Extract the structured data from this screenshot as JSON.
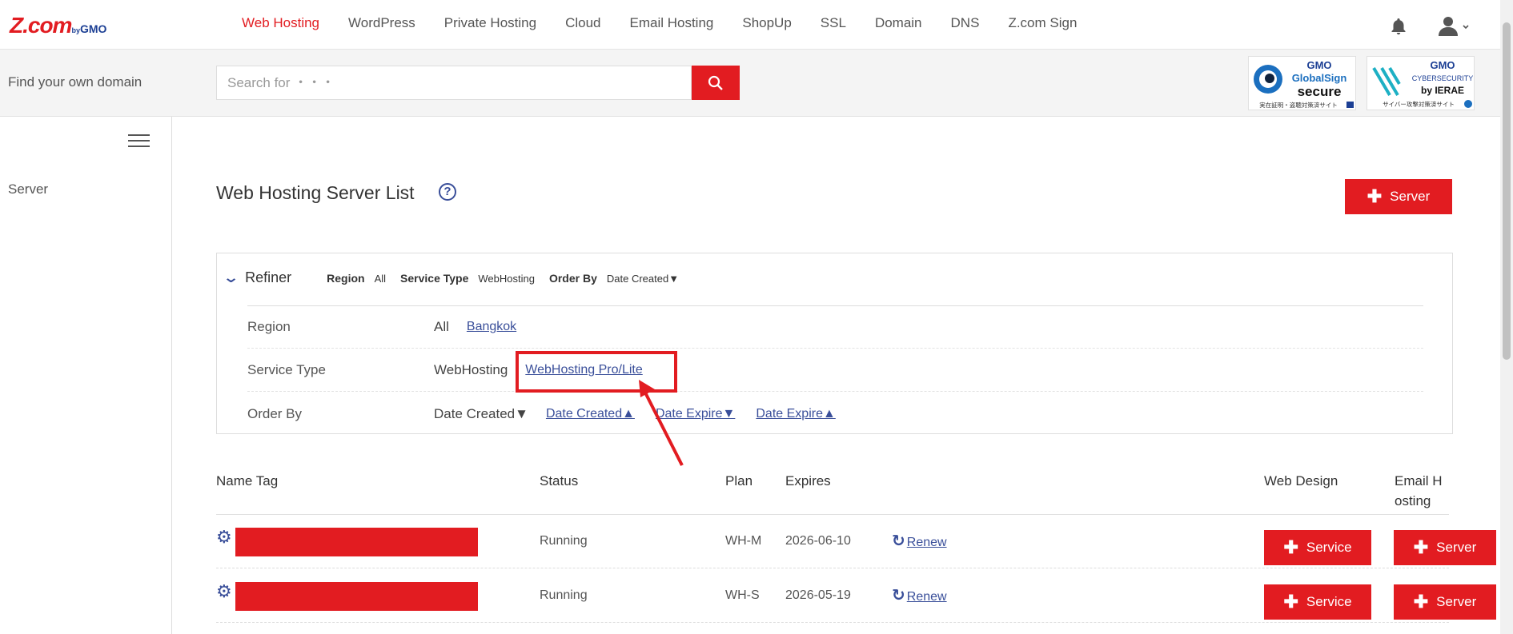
{
  "brand": {
    "logo_main": "Z.com",
    "logo_by": "by",
    "logo_gmo": "GMO"
  },
  "nav": {
    "items": [
      {
        "label": "Web Hosting",
        "active": true
      },
      {
        "label": "WordPress"
      },
      {
        "label": "Private Hosting"
      },
      {
        "label": "Cloud"
      },
      {
        "label": "Email Hosting"
      },
      {
        "label": "ShopUp"
      },
      {
        "label": "SSL"
      },
      {
        "label": "Domain"
      },
      {
        "label": "DNS"
      },
      {
        "label": "Z.com Sign"
      }
    ]
  },
  "search": {
    "label": "Find your own domain",
    "placeholder": "Search for ・・・"
  },
  "badges": {
    "globalsign": {
      "line1": "GMO",
      "line2": "GlobalSign",
      "line3": "secure",
      "line4": "実在証明・盗聴対策済サイト"
    },
    "ierae": {
      "line1": "GMO",
      "line2": "CYBERSECURITY",
      "line3": "by IERAE",
      "line4": "サイバー攻撃対策済サイト"
    }
  },
  "sidebar": {
    "items": [
      {
        "label": "Server"
      }
    ]
  },
  "page": {
    "title": "Web Hosting Server List",
    "add_button": "Server"
  },
  "refiner": {
    "title": "Refiner",
    "summary": {
      "region_label": "Region",
      "region_value": "All",
      "service_label": "Service Type",
      "service_value": "WebHosting",
      "order_label": "Order By",
      "order_value": "Date Created▼"
    },
    "rows": {
      "region": {
        "label": "Region",
        "current": "All",
        "links": [
          "Bangkok"
        ]
      },
      "service": {
        "label": "Service Type",
        "current": "WebHosting",
        "links": [
          "WebHosting Pro/Lite"
        ]
      },
      "order": {
        "label": "Order By",
        "current": "Date Created▼",
        "links": [
          "Date Created▲",
          "Date Expire▼",
          "Date Expire▲"
        ]
      }
    }
  },
  "table": {
    "headers": {
      "name_tag": "Name Tag",
      "status": "Status",
      "plan": "Plan",
      "expires": "Expires",
      "web_design": "Web Design",
      "email_line1": "Email H",
      "email_line2": "osting"
    },
    "rows": [
      {
        "status": "Running",
        "plan": "WH-M",
        "expires": "2026-06-10",
        "renew": "Renew",
        "web_design_btn": "Service",
        "email_btn": "Server"
      },
      {
        "status": "Running",
        "plan": "WH-S",
        "expires": "2026-05-19",
        "renew": "Renew",
        "web_design_btn": "Service",
        "email_btn": "Server"
      }
    ]
  },
  "colors": {
    "brand_red": "#e21c21",
    "link_blue": "#3a4f9a"
  }
}
